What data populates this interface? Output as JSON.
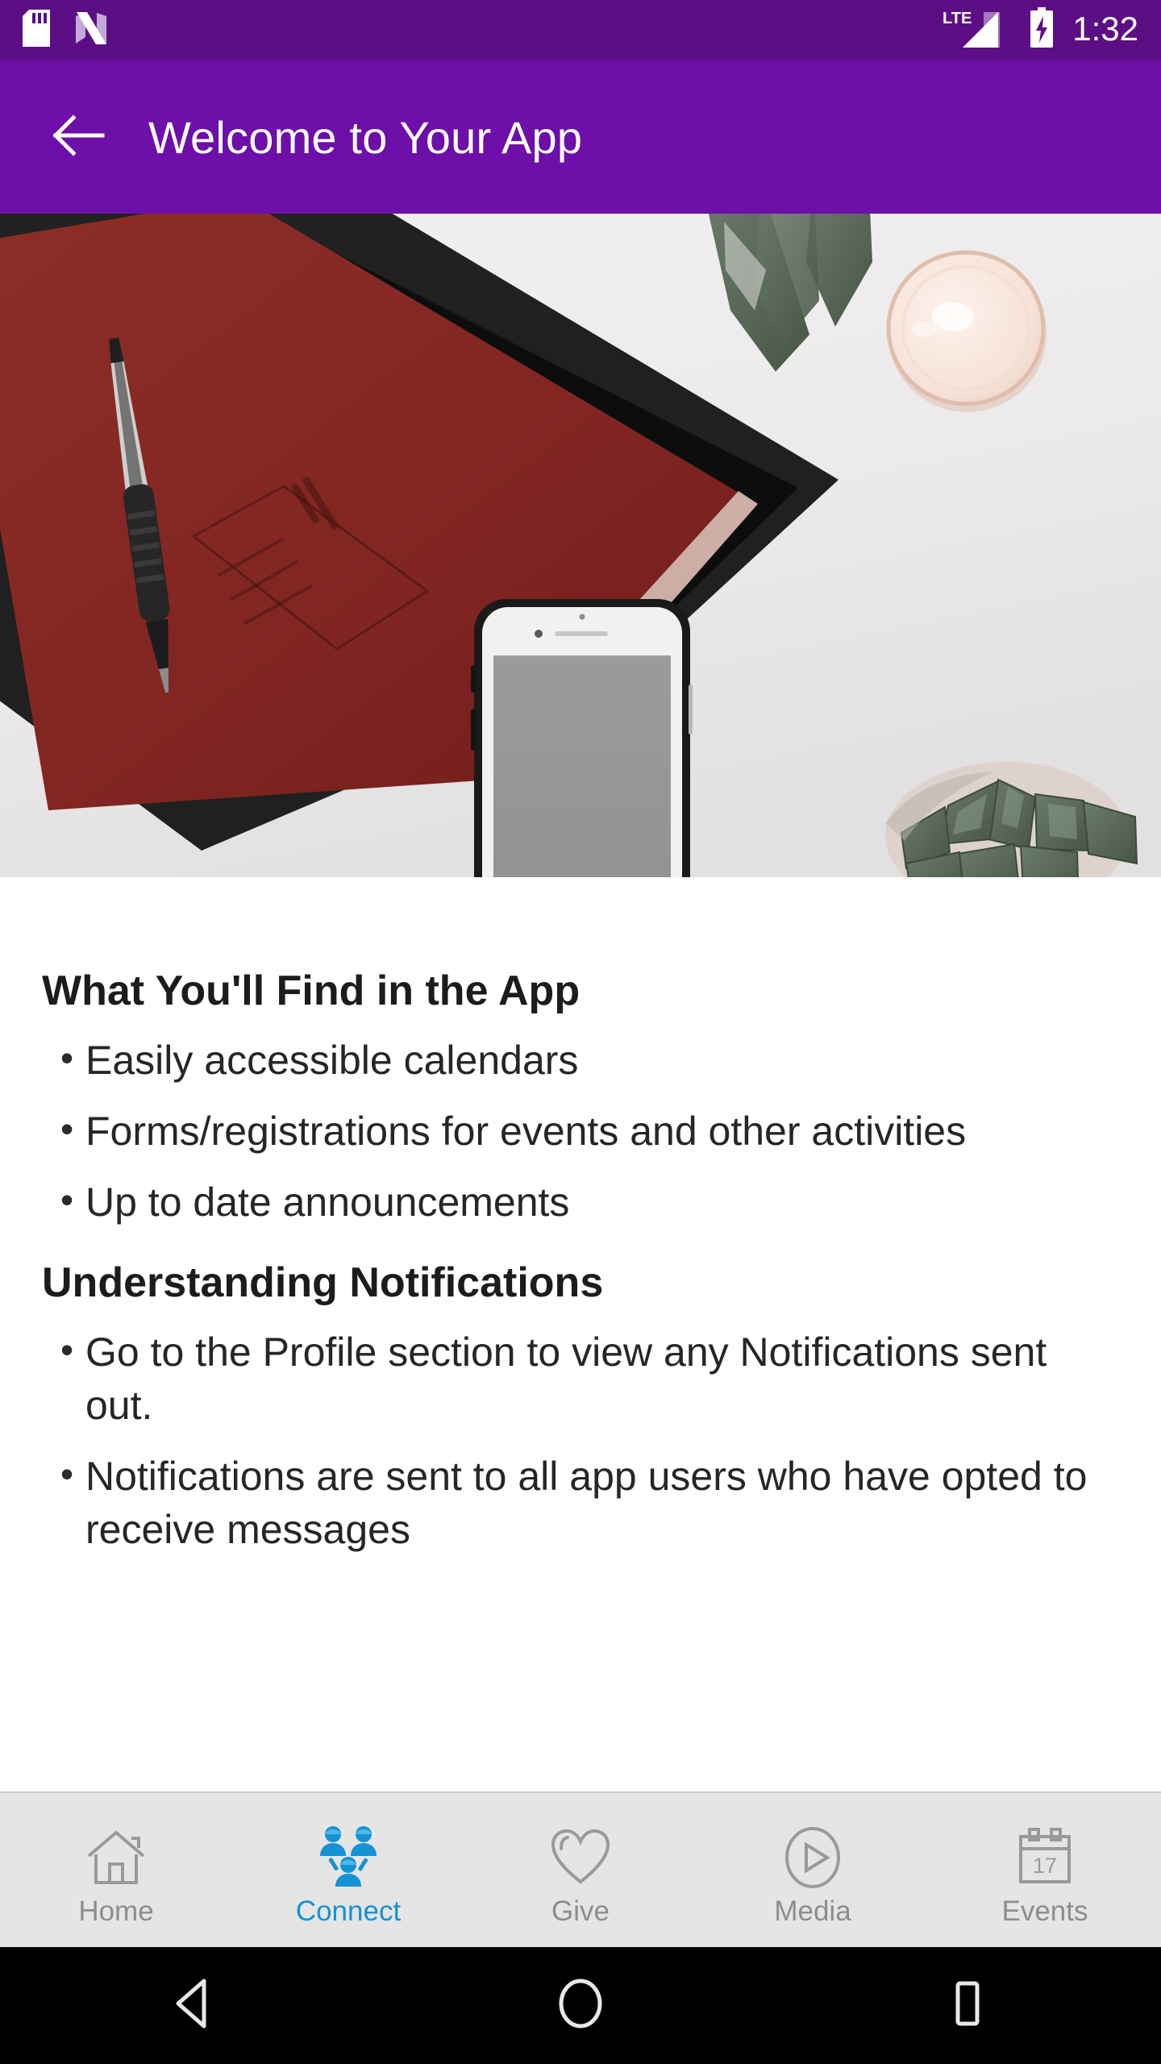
{
  "status_bar": {
    "time": "1:32",
    "network_label": "LTE",
    "icons": [
      "sd-card-icon",
      "android-nougat-icon",
      "lte-signal-icon",
      "battery-charging-icon"
    ],
    "background_color": "#5C0F84",
    "foreground_color": "#FFFFFF"
  },
  "app_bar": {
    "title": "Welcome to Your App",
    "back_icon": "arrow-left-icon",
    "background_color": "#6D0FA8",
    "text_color": "#FFFFFF"
  },
  "hero": {
    "alt": "Flat lay desk photo with red notebook, pen, white smartphone, cup and succulent plant",
    "colors": {
      "background": "#EBEAEA",
      "notebook_red": "#8C2B27",
      "notebook_black": "#131313",
      "phone_bezel": "#1A1A1A",
      "phone_body": "#F2F0EE",
      "phone_screen": "#989898",
      "cup_rim": "#E7C9BC",
      "cup_fill": "#F7E6DE",
      "plant_green": "#586A58"
    }
  },
  "content": {
    "sections": [
      {
        "heading": "What You'll Find in the App",
        "bullets": [
          "Easily accessible calendars",
          "Forms/registrations for events and other activities",
          "Up to date announcements"
        ]
      },
      {
        "heading": "Understanding Notifications",
        "bullets": [
          "Go to the Profile section to view any Notifications sent out.",
          "Notifications are sent to all app users who have opted to receive messages"
        ]
      }
    ],
    "bullet_glyph": "•",
    "text_color": "#262626"
  },
  "tab_bar": {
    "active_color": "#1592D4",
    "inactive_color": "#8D8D8D",
    "background_color": "#E5E5E5",
    "active_index": 1,
    "tabs": [
      {
        "label": "Home",
        "icon": "home-icon"
      },
      {
        "label": "Connect",
        "icon": "people-group-icon"
      },
      {
        "label": "Give",
        "icon": "heart-icon"
      },
      {
        "label": "Media",
        "icon": "play-circle-icon"
      },
      {
        "label": "Events",
        "icon": "calendar-icon",
        "badge": "17"
      }
    ]
  },
  "nav_bar": {
    "background_color": "#000000",
    "buttons": [
      {
        "name": "back",
        "icon": "triangle-left-icon"
      },
      {
        "name": "home",
        "icon": "circle-icon"
      },
      {
        "name": "recents",
        "icon": "square-icon"
      }
    ]
  }
}
